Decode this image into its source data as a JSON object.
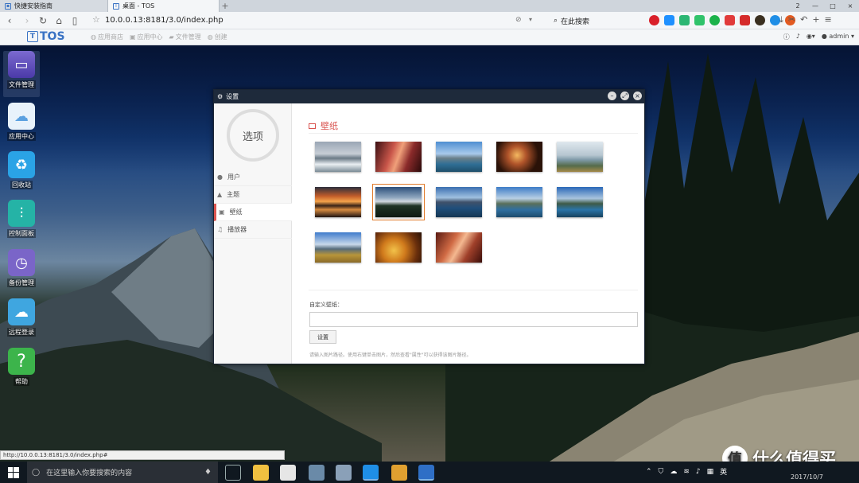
{
  "browser": {
    "tabs": [
      {
        "label": "快捷安装指南",
        "active": false
      },
      {
        "label": "桌面 - TOS",
        "active": true
      }
    ],
    "new_tab": "+",
    "window_controls": [
      "2",
      "—",
      "□",
      "×"
    ],
    "url": "10.0.0.13:8181/3.0/index.php",
    "search_placeholder": "在此搜索",
    "bookmarks": [
      "应用商店",
      "应用中心",
      "文件管理",
      "创建"
    ],
    "user": "admin",
    "status_url": "http://10.0.0.13:8181/3.0/index.php#"
  },
  "tos": {
    "logo": "TOS"
  },
  "desktop_icons": [
    {
      "label": "文件管理",
      "icon": "monitor-icon"
    },
    {
      "label": "应用中心",
      "icon": "cloud-bag-icon"
    },
    {
      "label": "回收站",
      "icon": "recycle-bin-icon"
    },
    {
      "label": "控制面板",
      "icon": "sliders-icon"
    },
    {
      "label": "备份管理",
      "icon": "clock-icon"
    },
    {
      "label": "远程登录",
      "icon": "cloud-icon"
    },
    {
      "label": "帮助",
      "icon": "question-icon"
    }
  ],
  "settings": {
    "title": "设置",
    "ring_label": "选项",
    "menu": [
      {
        "label": "用户",
        "icon": "user-icon",
        "active": false
      },
      {
        "label": "主题",
        "icon": "theme-icon",
        "active": false
      },
      {
        "label": "壁纸",
        "icon": "picture-icon",
        "active": true
      },
      {
        "label": "播放器",
        "icon": "music-icon",
        "active": false
      }
    ],
    "wallpaper_heading": "壁纸",
    "selected_index": 6,
    "custom_label": "自定义壁纸：",
    "custom_value": "",
    "set_button": "设置",
    "hint": "请输入图片路径。使用右键单击图片，然后查看\"属性\"可以获得该图片路径。"
  },
  "taskbar": {
    "search_placeholder": "在这里输入你要搜索的内容",
    "ime": "英",
    "date": "2017/10/7"
  },
  "watermark": {
    "text": "什么值得买",
    "badge": "值"
  }
}
